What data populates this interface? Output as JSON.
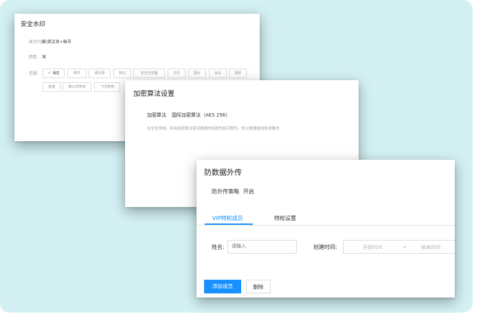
{
  "watermark_card": {
    "title": "安全水印",
    "display_label": "显示内容",
    "display_value": "中/英文名+帐号",
    "color_label": "颜色",
    "color_value": "深",
    "scope_label": "范围",
    "scope_tags": [
      {
        "label": "消息",
        "selected": true
      },
      {
        "label": "邮件",
        "selected": false
      },
      {
        "label": "通讯录",
        "selected": false
      },
      {
        "label": "知识",
        "selected": false
      },
      {
        "label": "安全浏览器",
        "selected": false
      },
      {
        "label": "文件",
        "selected": false
      },
      {
        "label": "图片",
        "selected": false
      },
      {
        "label": "会议",
        "selected": false
      },
      {
        "label": "视频",
        "selected": false
      },
      {
        "label": "直播",
        "selected": false
      },
      {
        "label": "腾公司表单",
        "selected": false
      },
      {
        "label": "飞羽表格",
        "selected": false
      }
    ]
  },
  "encryption_card": {
    "title": "加密算法设置",
    "algo_label": "加密算法",
    "algo_value": "国际加密算法（AES 256）",
    "description": "在安全领域，利用加密算法保证数据的保密性和完整性，防止数据被窃取或篡改"
  },
  "leak_card": {
    "title": "防数据外传",
    "policy_label": "防外传策略",
    "policy_value": "开启",
    "tabs": [
      {
        "label": "VIP特权成员",
        "active": true
      },
      {
        "label": "特权设置",
        "active": false
      }
    ],
    "name_label": "姓名:",
    "name_placeholder": "请输入",
    "created_label": "创建时间:",
    "start_placeholder": "开始时间",
    "range_sep": "~",
    "end_placeholder": "结束时间",
    "add_button": "添加成员",
    "delete_button": "删除"
  },
  "colors": {
    "background_panel": "#d3f0f3",
    "accent": "#1890ff"
  }
}
